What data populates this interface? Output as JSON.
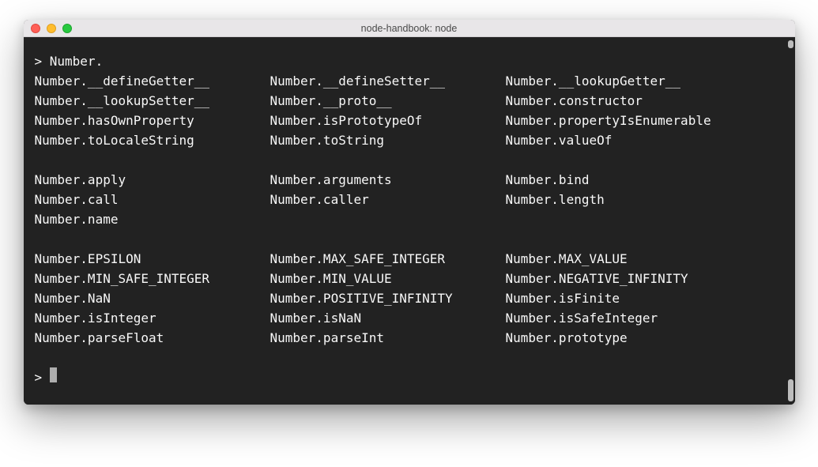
{
  "window": {
    "title": "node-handbook: node"
  },
  "prompt": {
    "symbol": "> ",
    "input": "Number."
  },
  "prompt2": {
    "symbol": "> "
  },
  "rows": {
    "g1r1": {
      "c1": "Number.__defineGetter__",
      "c2": "Number.__defineSetter__",
      "c3": "Number.__lookupGetter__"
    },
    "g1r2": {
      "c1": "Number.__lookupSetter__",
      "c2": "Number.__proto__",
      "c3": "Number.constructor"
    },
    "g1r3": {
      "c1": "Number.hasOwnProperty",
      "c2": "Number.isPrototypeOf",
      "c3": "Number.propertyIsEnumerable"
    },
    "g1r4": {
      "c1": "Number.toLocaleString",
      "c2": "Number.toString",
      "c3": "Number.valueOf"
    },
    "g2r1": {
      "c1": "Number.apply",
      "c2": "Number.arguments",
      "c3": "Number.bind"
    },
    "g2r2": {
      "c1": "Number.call",
      "c2": "Number.caller",
      "c3": "Number.length"
    },
    "g2r3": {
      "c1": "Number.name",
      "c2": "",
      "c3": ""
    },
    "g3r1": {
      "c1": "Number.EPSILON",
      "c2": "Number.MAX_SAFE_INTEGER",
      "c3": "Number.MAX_VALUE"
    },
    "g3r2": {
      "c1": "Number.MIN_SAFE_INTEGER",
      "c2": "Number.MIN_VALUE",
      "c3": "Number.NEGATIVE_INFINITY"
    },
    "g3r3": {
      "c1": "Number.NaN",
      "c2": "Number.POSITIVE_INFINITY",
      "c3": "Number.isFinite"
    },
    "g3r4": {
      "c1": "Number.isInteger",
      "c2": "Number.isNaN",
      "c3": "Number.isSafeInteger"
    },
    "g3r5": {
      "c1": "Number.parseFloat",
      "c2": "Number.parseInt",
      "c3": "Number.prototype"
    }
  }
}
